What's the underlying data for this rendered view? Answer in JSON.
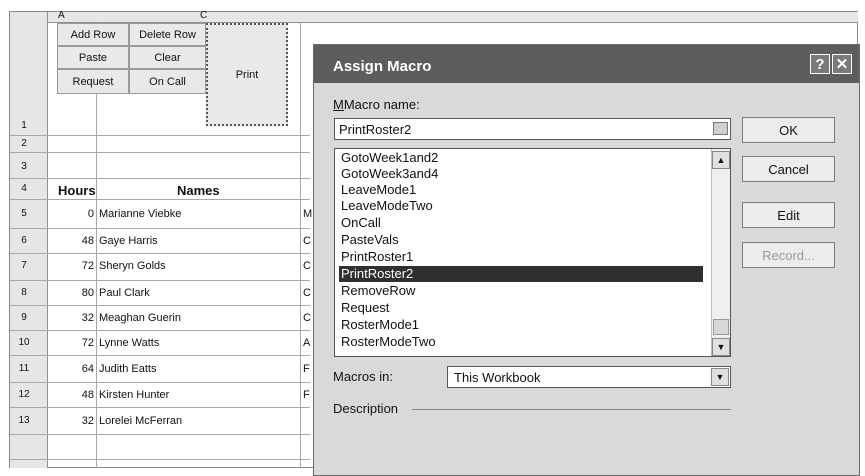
{
  "sheet": {
    "col_headers": [
      "A",
      "C"
    ],
    "form_buttons": {
      "add_row": "Add Row",
      "delete_row": "Delete Row",
      "paste": "Paste",
      "clear": "Clear",
      "print": "Print",
      "request": "Request",
      "on_call": "On Call"
    },
    "header_row": {
      "hours": "Hours",
      "names": "Names"
    },
    "row_numbers": [
      "1",
      "2",
      "3",
      "4",
      "5",
      "6",
      "7",
      "8",
      "9",
      "10",
      "11",
      "12",
      "13"
    ],
    "rows": [
      {
        "hours": "0",
        "name": "Marianne Viebke",
        "next": "M"
      },
      {
        "hours": "48",
        "name": "Gaye Harris",
        "next": "C"
      },
      {
        "hours": "72",
        "name": "Sheryn Golds",
        "next": "C"
      },
      {
        "hours": "80",
        "name": "Paul Clark",
        "next": "C"
      },
      {
        "hours": "32",
        "name": "Meaghan Guerin",
        "next": "C"
      },
      {
        "hours": "72",
        "name": "Lynne Watts",
        "next": "A"
      },
      {
        "hours": "64",
        "name": "Judith Eatts",
        "next": "F"
      },
      {
        "hours": "48",
        "name": "Kirsten Hunter",
        "next": "F"
      },
      {
        "hours": "32",
        "name": "Lorelei McFerran",
        "next": ""
      }
    ]
  },
  "dialog": {
    "title": "Assign Macro",
    "help_glyph": "?",
    "close_glyph": "✕",
    "macro_name_label": "Macro name:",
    "macro_name_value": "PrintRoster2",
    "macro_list": [
      "GotoWeek1and2",
      "GotoWeek3and4",
      "LeaveMode1",
      "LeaveModeTwo",
      "OnCall",
      "PasteVals",
      "PrintRoster1",
      "PrintRoster2",
      "RemoveRow",
      "Request",
      "RosterMode1",
      "RosterModeTwo"
    ],
    "selected_macro": "PrintRoster2",
    "macros_in_label": "Macros in:",
    "macros_in_value": "This Workbook",
    "description_label": "Description",
    "buttons": {
      "ok": "OK",
      "cancel": "Cancel",
      "edit": "Edit",
      "record": "Record..."
    }
  }
}
